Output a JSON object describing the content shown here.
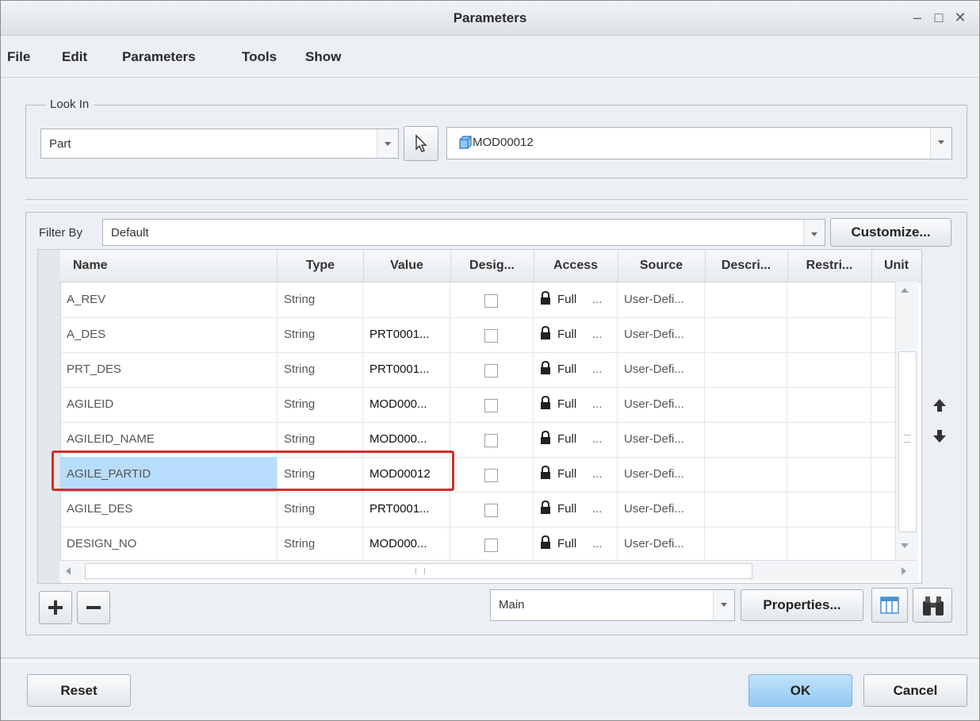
{
  "window": {
    "title": "Parameters"
  },
  "menu": [
    "File",
    "Edit",
    "Parameters",
    "Tools",
    "Show"
  ],
  "look_in": {
    "legend": "Look In",
    "scope": "Part",
    "model": "MOD00012"
  },
  "filter": {
    "label": "Filter By",
    "value": "Default",
    "customize": "Customize..."
  },
  "table": {
    "columns": [
      "Name",
      "Type",
      "Value",
      "Desig...",
      "Access",
      "Source",
      "Descri...",
      "Restri...",
      "Unit"
    ],
    "rows": [
      {
        "name": "A_REV",
        "type": "String",
        "value": "",
        "access": "Full",
        "access_more": "...",
        "source": "User-Defi..."
      },
      {
        "name": "A_DES",
        "type": "String",
        "value": "PRT0001...",
        "access": "Full",
        "access_more": "...",
        "source": "User-Defi..."
      },
      {
        "name": "PRT_DES",
        "type": "String",
        "value": "PRT0001...",
        "access": "Full",
        "access_more": "...",
        "source": "User-Defi..."
      },
      {
        "name": "AGILEID",
        "type": "String",
        "value": "MOD000...",
        "access": "Full",
        "access_more": "...",
        "source": "User-Defi..."
      },
      {
        "name": "AGILEID_NAME",
        "type": "String",
        "value": "MOD000...",
        "access": "Full",
        "access_more": "...",
        "source": "User-Defi..."
      },
      {
        "name": "AGILE_PARTID",
        "type": "String",
        "value": "MOD00012",
        "access": "Full",
        "access_more": "...",
        "source": "User-Defi...",
        "selected": true
      },
      {
        "name": "AGILE_DES",
        "type": "String",
        "value": "PRT0001...",
        "access": "Full",
        "access_more": "...",
        "source": "User-Defi..."
      },
      {
        "name": "DESIGN_NO",
        "type": "String",
        "value": "MOD000...",
        "access": "Full",
        "access_more": "...",
        "source": "User-Defi..."
      }
    ]
  },
  "bottom": {
    "view": "Main",
    "properties": "Properties..."
  },
  "footer": {
    "reset": "Reset",
    "ok": "OK",
    "cancel": "Cancel"
  },
  "colors": {
    "selection": "#b8dcfb",
    "highlight_box": "#d62b2b",
    "ok_button": "#a7d4f3"
  },
  "icons": [
    "minimize-icon",
    "maximize-icon",
    "close-icon",
    "select-cursor-icon",
    "part-cube-icon",
    "lock-icon",
    "arrow-up-icon",
    "arrow-down-icon",
    "plus-icon",
    "minus-icon",
    "table-columns-icon",
    "binoculars-icon"
  ]
}
